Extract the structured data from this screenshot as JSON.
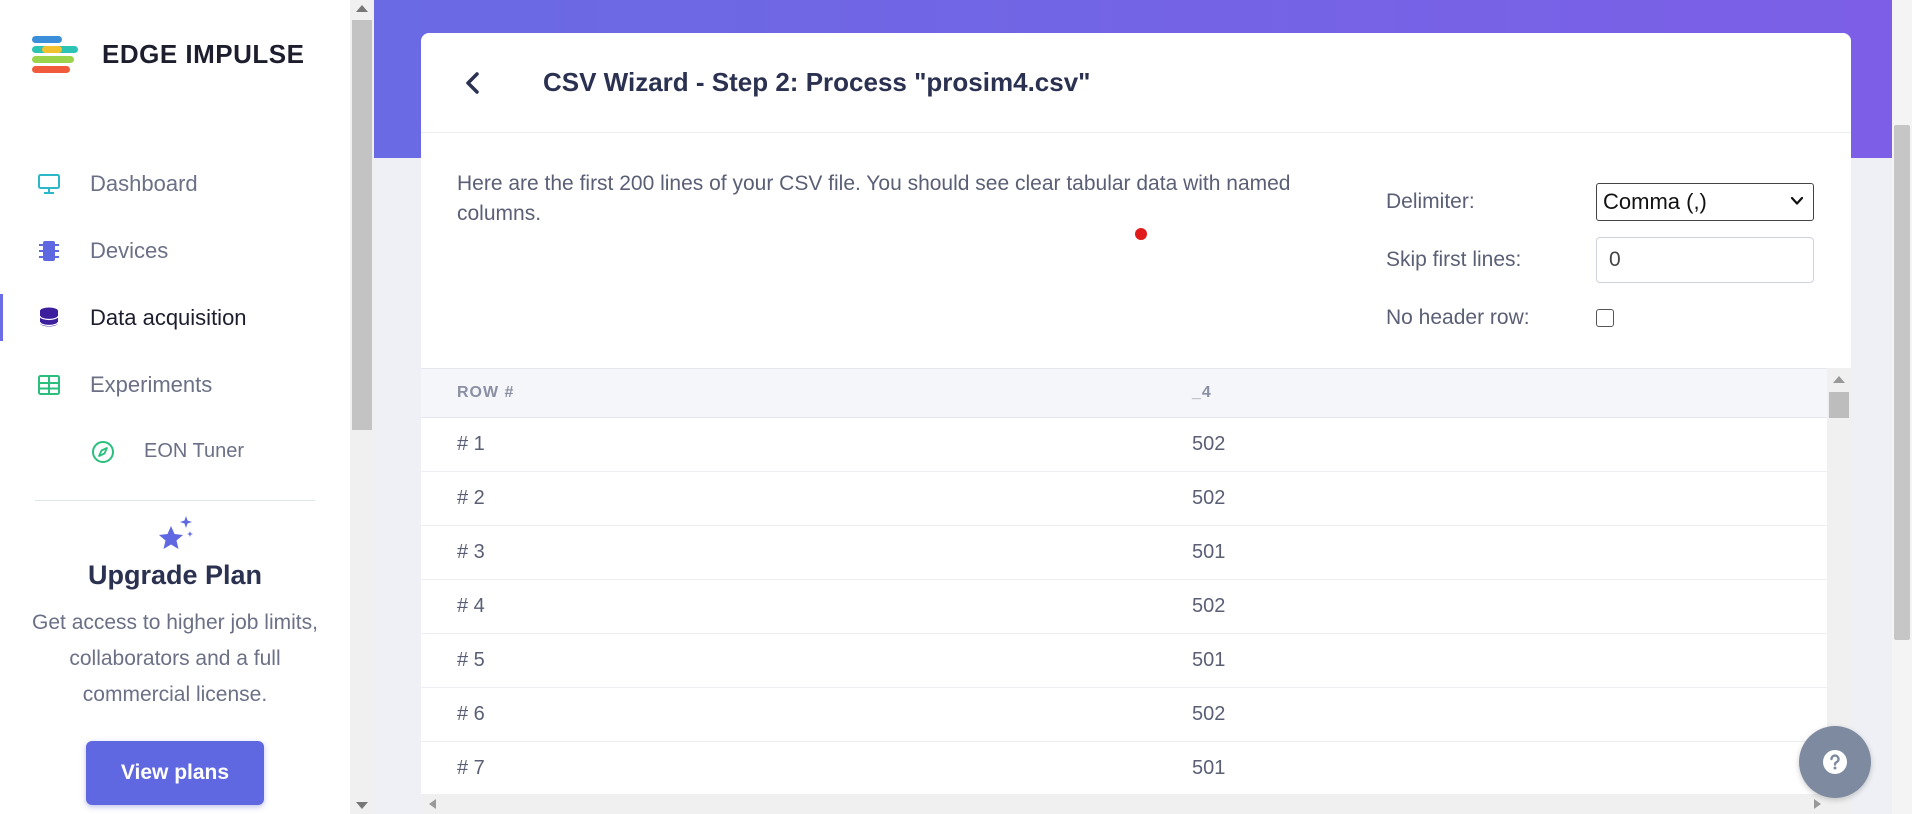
{
  "brand": {
    "name": "EDGE IMPULSE"
  },
  "sidebar": {
    "items": [
      {
        "label": "Dashboard",
        "icon": "monitor-icon",
        "active": false
      },
      {
        "label": "Devices",
        "icon": "chip-icon",
        "active": false
      },
      {
        "label": "Data acquisition",
        "icon": "database-icon",
        "active": true
      },
      {
        "label": "Experiments",
        "icon": "grid-table-icon",
        "active": false
      },
      {
        "label": "EON Tuner",
        "icon": "compass-icon",
        "active": false,
        "sub": true
      }
    ],
    "upgrade": {
      "title": "Upgrade Plan",
      "text": "Get access to higher job limits, collaborators and a full commercial license.",
      "button": "View plans"
    }
  },
  "wizard": {
    "title": "CSV Wizard - Step 2: Process \"prosim4.csv\"",
    "intro": "Here are the first 200 lines of your CSV file. You should see clear tabular data with named columns.",
    "options": {
      "delimiter_label": "Delimiter:",
      "delimiter_value": "Comma (,)",
      "skip_label": "Skip first lines:",
      "skip_value": "0",
      "noheader_label": "No header row:",
      "noheader_checked": false
    },
    "table": {
      "columns": [
        "ROW #",
        "_4"
      ],
      "rows": [
        [
          "# 1",
          "502"
        ],
        [
          "# 2",
          "502"
        ],
        [
          "# 3",
          "501"
        ],
        [
          "# 4",
          "502"
        ],
        [
          "# 5",
          "501"
        ],
        [
          "# 6",
          "502"
        ],
        [
          "# 7",
          "501"
        ]
      ]
    }
  },
  "colors": {
    "accent": "#5f68e0",
    "banner_start": "#6a6ae4",
    "banner_end": "#7c5fe6",
    "marker": "#e11b1b"
  }
}
